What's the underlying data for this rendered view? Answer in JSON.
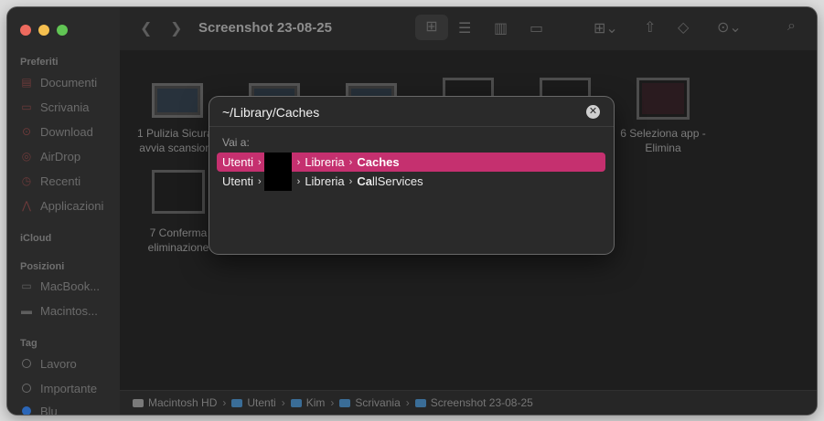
{
  "window": {
    "title": "Screenshot 23-08-25"
  },
  "sidebar": {
    "sections": [
      {
        "label": "Preferiti"
      },
      {
        "label": "iCloud"
      },
      {
        "label": "Posizioni"
      },
      {
        "label": "Tag"
      }
    ],
    "favorites": [
      {
        "label": "Documenti",
        "icon": "document-icon"
      },
      {
        "label": "Scrivania",
        "icon": "desktop-icon"
      },
      {
        "label": "Download",
        "icon": "download-icon"
      },
      {
        "label": "AirDrop",
        "icon": "airdrop-icon"
      },
      {
        "label": "Recenti",
        "icon": "clock-icon"
      },
      {
        "label": "Applicazioni",
        "icon": "applications-icon"
      }
    ],
    "locations": [
      {
        "label": "MacBook...",
        "icon": "laptop-icon"
      },
      {
        "label": "Macintos...",
        "icon": "disk-icon"
      }
    ],
    "tags": [
      {
        "label": "Lavoro"
      },
      {
        "label": "Importante"
      },
      {
        "label": "Blu"
      }
    ]
  },
  "files": [
    {
      "line1": "1 Pulizia Sicura -",
      "line2": "avvia scansione"
    },
    {
      "line1": "",
      "line2": ""
    },
    {
      "line1": "",
      "line2": ""
    },
    {
      "line1": "",
      "line2": ""
    },
    {
      "line1": "",
      "line2": ""
    },
    {
      "line1": "6 Seleziona app -",
      "line2": "Elimina"
    },
    {
      "line1": "7 Conferma",
      "line2": "eliminazione"
    }
  ],
  "dialog": {
    "path_value": "~/Library/Caches",
    "goto_label": "Vai a:",
    "results": [
      {
        "part1": "Utenti",
        "part2": "Libreria",
        "part3_bold": "Caches",
        "part3_rest": "",
        "selected": true
      },
      {
        "part1": "Utenti",
        "part2": "Libreria",
        "part3_bold": "Ca",
        "part3_rest": "llServices",
        "selected": false
      }
    ]
  },
  "statusbar": {
    "crumbs": [
      "Macintosh HD",
      "Utenti",
      "Kim",
      "Scrivania",
      "Screenshot 23-08-25"
    ]
  },
  "colors": {
    "accent": "#c5306f",
    "folder": "#3a6d97"
  }
}
